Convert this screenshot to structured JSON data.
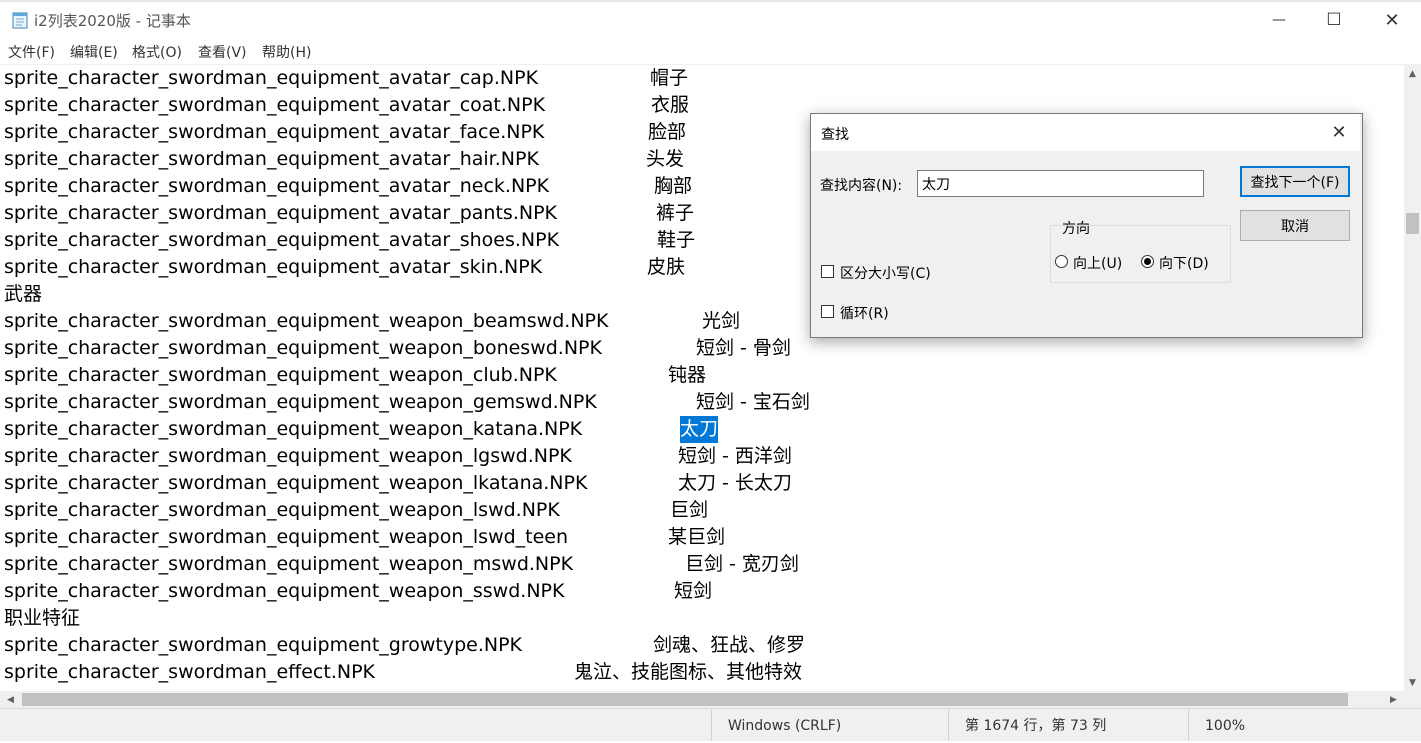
{
  "window": {
    "title": "i2列表2020版 - 记事本",
    "minimize_glyph": "—",
    "maximize_glyph": "☐",
    "close_glyph": "✕"
  },
  "menu": [
    "文件(F)",
    "编辑(E)",
    "格式(O)",
    "查看(V)",
    "帮助(H)"
  ],
  "lines": [
    {
      "file": "sprite_character_swordman_equipment_avatar_cap.NPK",
      "note": "帽子"
    },
    {
      "file": "sprite_character_swordman_equipment_avatar_coat.NPK",
      "note": "衣服"
    },
    {
      "file": "sprite_character_swordman_equipment_avatar_face.NPK",
      "note": "脸部"
    },
    {
      "file": "sprite_character_swordman_equipment_avatar_hair.NPK",
      "note": "头发"
    },
    {
      "file": "sprite_character_swordman_equipment_avatar_neck.NPK",
      "note": "胸部"
    },
    {
      "file": "sprite_character_swordman_equipment_avatar_pants.NPK",
      "note": "裤子"
    },
    {
      "file": "sprite_character_swordman_equipment_avatar_shoes.NPK",
      "note": "鞋子"
    },
    {
      "file": "sprite_character_swordman_equipment_avatar_skin.NPK",
      "note": "皮肤"
    },
    {
      "file": "武器",
      "note": ""
    },
    {
      "file": "sprite_character_swordman_equipment_weapon_beamswd.NPK",
      "note": "光剑"
    },
    {
      "file": "sprite_character_swordman_equipment_weapon_boneswd.NPK",
      "note": "短剑 - 骨剑"
    },
    {
      "file": "sprite_character_swordman_equipment_weapon_club.NPK",
      "note": "钝器"
    },
    {
      "file": "sprite_character_swordman_equipment_weapon_gemswd.NPK",
      "note": "短剑 - 宝石剑"
    },
    {
      "file": "sprite_character_swordman_equipment_weapon_katana.NPK",
      "note": "太刀"
    },
    {
      "file": "sprite_character_swordman_equipment_weapon_lgswd.NPK",
      "note": "短剑 - 西洋剑"
    },
    {
      "file": "sprite_character_swordman_equipment_weapon_lkatana.NPK",
      "note": "太刀 - 长太刀"
    },
    {
      "file": "sprite_character_swordman_equipment_weapon_lswd.NPK",
      "note": "巨剑"
    },
    {
      "file": "sprite_character_swordman_equipment_weapon_lswd_teen",
      "note": "某巨剑"
    },
    {
      "file": "sprite_character_swordman_equipment_weapon_mswd.NPK",
      "note": "巨剑 - 宽刃剑"
    },
    {
      "file": "sprite_character_swordman_equipment_weapon_sswd.NPK",
      "note": "短剑"
    },
    {
      "file": "职业特征",
      "note": ""
    },
    {
      "file": "sprite_character_swordman_equipment_growtype.NPK",
      "note": "剑魂、狂战、修罗"
    },
    {
      "file": "sprite_character_swordman_effect.NPK",
      "note": "鬼泣、技能图标、其他特效"
    }
  ],
  "selected_line_index": 13,
  "status": {
    "encoding": "Windows (CRLF)",
    "position": "第 1674 行，第 73 列",
    "zoom": "100%"
  },
  "find_dialog": {
    "title": "查找",
    "find_label": "查找内容(N):",
    "find_value": "太刀",
    "find_next_label": "查找下一个(F)",
    "cancel_label": "取消",
    "direction_label": "方向",
    "up_label": "向上(U)",
    "down_label": "向下(D)",
    "direction_selected": "down",
    "match_case_label": "区分大小写(C)",
    "match_case_checked": false,
    "wrap_label": "循环(R)",
    "wrap_checked": false
  },
  "colors": {
    "selection": "#0078d7",
    "primary_button_border": "#0078d7"
  },
  "scrollbars": {
    "vertical_position_fraction": 0.23,
    "horizontal_visible_fraction": 0.96
  }
}
